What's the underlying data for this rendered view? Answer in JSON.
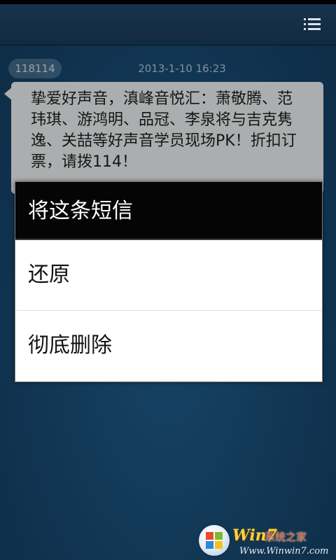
{
  "conversation": {
    "sender": "118114",
    "timestamp": "2013-1-10 16:23",
    "message_text": "挚爱好声音，滇峰音悦汇：萧敬腾、范玮琪、游鸿明、品冠、李泉将与吉克隽逸、关喆等好声音学员现场PK！折扣订票，请拨114！"
  },
  "dialog": {
    "title": "将这条短信",
    "options": [
      {
        "label": "还原"
      },
      {
        "label": "彻底删除"
      }
    ]
  },
  "icons": {
    "menu": "menu-icon",
    "watermark_logo": "windows-logo-icon"
  },
  "watermark": {
    "brand": "Win7",
    "tagline": "系统之家",
    "url": "Www.Winwin7.com"
  },
  "colors": {
    "background": "#184b73",
    "top_bar": "#14304a",
    "bubble": "#e5e7e9",
    "dialog_title_bg": "#050505",
    "dialog_bg": "#ffffff"
  }
}
